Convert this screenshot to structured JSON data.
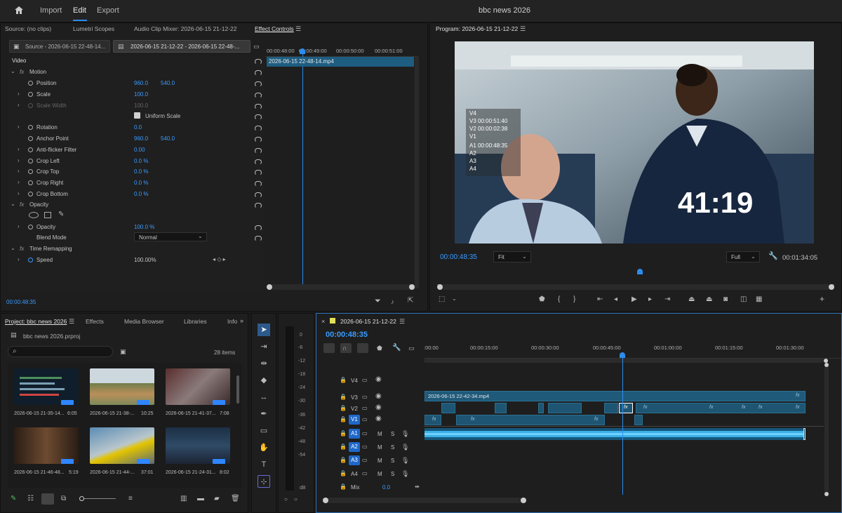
{
  "app": {
    "title": "bbc news 2026",
    "menu": [
      "Import",
      "Edit",
      "Export"
    ]
  },
  "source_panel": {
    "tabs": [
      "Source: (no clips)",
      "Lumetri Scopes",
      "Audio Clip Mixer: 2026-06-15 21-12-22",
      "Effect Controls"
    ],
    "source_dropdown": "Source - 2026-06-15 22-48-14...",
    "sequence_dropdown": "2026-06-15 21-12-22 - 2026-06-15 22-48-...",
    "ruler": [
      "00:00:48:00",
      "00:00:49:00",
      "00:00:50:00",
      "00:00:51:00"
    ],
    "clip_name": "2026-06-15 22-48-14.mp4",
    "video_header": "Video",
    "motion": "Motion",
    "props": {
      "position": {
        "label": "Position",
        "x": "960.0",
        "y": "540.0"
      },
      "scale": {
        "label": "Scale",
        "value": "100.0"
      },
      "scale_width": {
        "label": "Scale Width",
        "value": "100.0"
      },
      "uniform_scale": "Uniform Scale",
      "rotation": {
        "label": "Rotation",
        "value": "0.0"
      },
      "anchor": {
        "label": "Anchor Point",
        "x": "960.0",
        "y": "540.0"
      },
      "antiflicker": {
        "label": "Anti-flicker Filter",
        "value": "0.00"
      },
      "crop_left": {
        "label": "Crop Left",
        "value": "0.0 %"
      },
      "crop_top": {
        "label": "Crop Top",
        "value": "0.0 %"
      },
      "crop_right": {
        "label": "Crop Right",
        "value": "0.0 %"
      },
      "crop_bottom": {
        "label": "Crop Bottom",
        "value": "0.0 %"
      },
      "opacity_header": "Opacity",
      "opacity": {
        "label": "Opacity",
        "value": "100.0 %"
      },
      "blend": {
        "label": "Blend Mode",
        "value": "Normal"
      },
      "time_remap": "Time Remapping",
      "speed": {
        "label": "Speed",
        "value": "100.00%"
      }
    },
    "timecode": "00:00:48:35"
  },
  "program": {
    "title": "Program: 2026-06-15 21-12-22",
    "overlay": [
      "V4",
      "V3 00:00:51:40",
      "V2 00:00:02:38",
      "V1",
      "A1 00:00:48:35",
      "A2",
      "A3",
      "A4"
    ],
    "big_time": "41:19",
    "timecode": "00:00:48:35",
    "fit": "Fit",
    "full": "Full",
    "duration": "00:01:34:05"
  },
  "project": {
    "tabs": [
      "Project: bbc news 2026",
      "Effects",
      "Media Browser",
      "Libraries",
      "Info"
    ],
    "file": "bbc news 2026.prproj",
    "items_count": "28 items",
    "thumbs": [
      {
        "name": "2026-06-15 21-35-14...",
        "dur": "6:05"
      },
      {
        "name": "2026-06-15 21-38-...",
        "dur": "10:25"
      },
      {
        "name": "2026-06-15 21-41-37...",
        "dur": "7:08"
      },
      {
        "name": "2026-06-15 21-46-48...",
        "dur": "5:19"
      },
      {
        "name": "2026-06-15 21-44-...",
        "dur": "37:01"
      },
      {
        "name": "2026-06-15 21-24-31...",
        "dur": "8:02"
      }
    ]
  },
  "meter": {
    "ticks": [
      "0",
      "-6",
      "-12",
      "-18",
      "-24",
      "-30",
      "-36",
      "-42",
      "-48",
      "-54",
      "dB"
    ]
  },
  "timeline": {
    "title": "2026-06-15 21-12-22",
    "timecode": "00:00:48:35",
    "ruler": [
      ":00:00",
      "00:00:15:00",
      "00:00:30:00",
      "00:00:45:00",
      "00:01:00:00",
      "00:01:15:00",
      "00:01:30:00"
    ],
    "tracks_video": [
      "V4",
      "V3",
      "V2",
      "V1"
    ],
    "tracks_audio": [
      "A1",
      "A2",
      "A3",
      "A4"
    ],
    "v3_clip": "2026-06-15 22-42-34.mp4",
    "mix_label": "Mix",
    "mix_value": "0.0"
  },
  "colors": {
    "accent": "#2d8ceb",
    "clip": "#1f5a7a",
    "audio": "#3ab0e6"
  }
}
